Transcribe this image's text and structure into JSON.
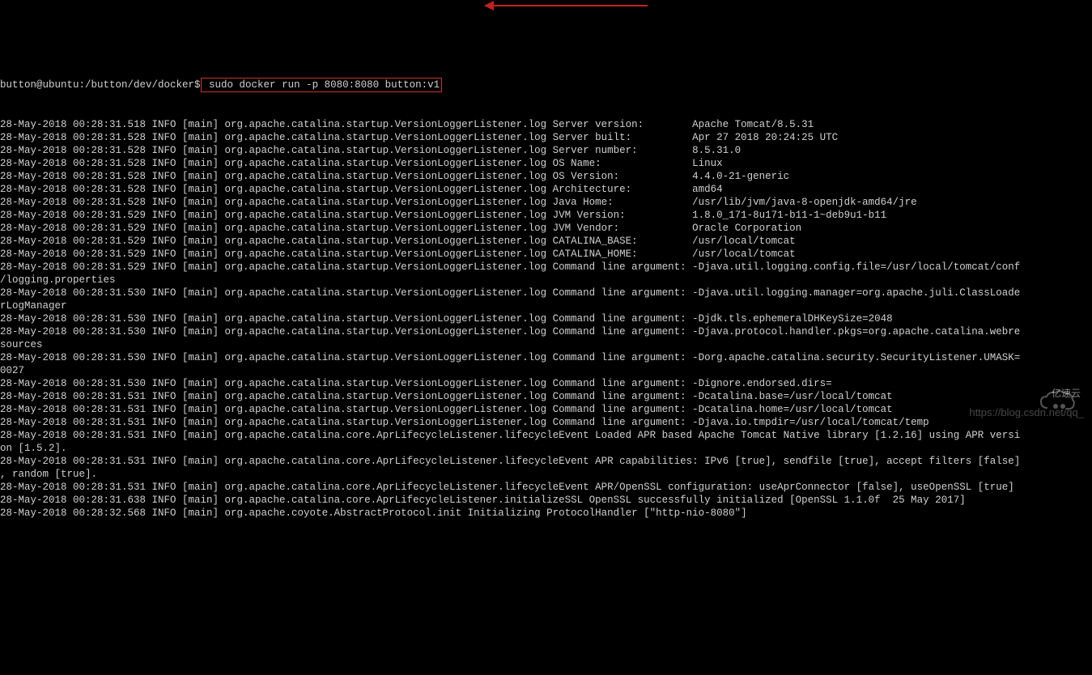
{
  "prompt": "button@ubuntu:/button/dev/docker$",
  "command": " sudo docker run -p 8080:8080 button:v1",
  "log_lines": [
    "28-May-2018 00:28:31.518 INFO [main] org.apache.catalina.startup.VersionLoggerListener.log Server version:        Apache Tomcat/8.5.31",
    "28-May-2018 00:28:31.528 INFO [main] org.apache.catalina.startup.VersionLoggerListener.log Server built:          Apr 27 2018 20:24:25 UTC",
    "28-May-2018 00:28:31.528 INFO [main] org.apache.catalina.startup.VersionLoggerListener.log Server number:         8.5.31.0",
    "28-May-2018 00:28:31.528 INFO [main] org.apache.catalina.startup.VersionLoggerListener.log OS Name:               Linux",
    "28-May-2018 00:28:31.528 INFO [main] org.apache.catalina.startup.VersionLoggerListener.log OS Version:            4.4.0-21-generic",
    "28-May-2018 00:28:31.528 INFO [main] org.apache.catalina.startup.VersionLoggerListener.log Architecture:          amd64",
    "28-May-2018 00:28:31.528 INFO [main] org.apache.catalina.startup.VersionLoggerListener.log Java Home:             /usr/lib/jvm/java-8-openjdk-amd64/jre",
    "28-May-2018 00:28:31.529 INFO [main] org.apache.catalina.startup.VersionLoggerListener.log JVM Version:           1.8.0_171-8u171-b11-1~deb9u1-b11",
    "28-May-2018 00:28:31.529 INFO [main] org.apache.catalina.startup.VersionLoggerListener.log JVM Vendor:            Oracle Corporation",
    "28-May-2018 00:28:31.529 INFO [main] org.apache.catalina.startup.VersionLoggerListener.log CATALINA_BASE:         /usr/local/tomcat",
    "28-May-2018 00:28:31.529 INFO [main] org.apache.catalina.startup.VersionLoggerListener.log CATALINA_HOME:         /usr/local/tomcat",
    "28-May-2018 00:28:31.529 INFO [main] org.apache.catalina.startup.VersionLoggerListener.log Command line argument: -Djava.util.logging.config.file=/usr/local/tomcat/conf",
    "/logging.properties",
    "28-May-2018 00:28:31.530 INFO [main] org.apache.catalina.startup.VersionLoggerListener.log Command line argument: -Djava.util.logging.manager=org.apache.juli.ClassLoade",
    "rLogManager",
    "28-May-2018 00:28:31.530 INFO [main] org.apache.catalina.startup.VersionLoggerListener.log Command line argument: -Djdk.tls.ephemeralDHKeySize=2048",
    "28-May-2018 00:28:31.530 INFO [main] org.apache.catalina.startup.VersionLoggerListener.log Command line argument: -Djava.protocol.handler.pkgs=org.apache.catalina.webre",
    "sources",
    "28-May-2018 00:28:31.530 INFO [main] org.apache.catalina.startup.VersionLoggerListener.log Command line argument: -Dorg.apache.catalina.security.SecurityListener.UMASK=",
    "0027",
    "28-May-2018 00:28:31.530 INFO [main] org.apache.catalina.startup.VersionLoggerListener.log Command line argument: -Dignore.endorsed.dirs=",
    "28-May-2018 00:28:31.531 INFO [main] org.apache.catalina.startup.VersionLoggerListener.log Command line argument: -Dcatalina.base=/usr/local/tomcat",
    "28-May-2018 00:28:31.531 INFO [main] org.apache.catalina.startup.VersionLoggerListener.log Command line argument: -Dcatalina.home=/usr/local/tomcat",
    "28-May-2018 00:28:31.531 INFO [main] org.apache.catalina.startup.VersionLoggerListener.log Command line argument: -Djava.io.tmpdir=/usr/local/tomcat/temp",
    "28-May-2018 00:28:31.531 INFO [main] org.apache.catalina.core.AprLifecycleListener.lifecycleEvent Loaded APR based Apache Tomcat Native library [1.2.16] using APR versi",
    "on [1.5.2].",
    "28-May-2018 00:28:31.531 INFO [main] org.apache.catalina.core.AprLifecycleListener.lifecycleEvent APR capabilities: IPv6 [true], sendfile [true], accept filters [false]",
    ", random [true].",
    "28-May-2018 00:28:31.531 INFO [main] org.apache.catalina.core.AprLifecycleListener.lifecycleEvent APR/OpenSSL configuration: useAprConnector [false], useOpenSSL [true]",
    "28-May-2018 00:28:31.638 INFO [main] org.apache.catalina.core.AprLifecycleListener.initializeSSL OpenSSL successfully initialized [OpenSSL 1.1.0f  25 May 2017]",
    "28-May-2018 00:28:32.568 INFO [main] org.apache.coyote.AbstractProtocol.init Initializing ProtocolHandler [\"http-nio-8080\"]"
  ],
  "watermark_url": "https://blog.csdn.net/qq_",
  "watermark_cn": "亿速云"
}
